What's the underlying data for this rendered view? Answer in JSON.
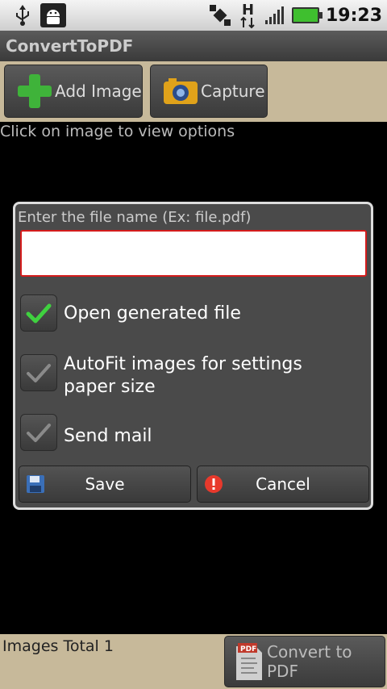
{
  "status_bar": {
    "time": "19:23"
  },
  "app": {
    "title": "ConvertToPDF"
  },
  "toolbar": {
    "add_image_label": "Add Image",
    "capture_label": "Capture"
  },
  "hint": "Click on image to view options",
  "dialog": {
    "file_label": "Enter the file name (Ex: file.pdf)",
    "file_value": "",
    "options": [
      {
        "label": "Open generated file",
        "checked": true
      },
      {
        "label": "AutoFit images for settings paper size",
        "checked": false
      },
      {
        "label": "Send mail",
        "checked": false
      }
    ],
    "save_label": "Save",
    "cancel_label": "Cancel"
  },
  "footer": {
    "images_total": "Images Total 1",
    "convert_label": "Convert to PDF"
  },
  "colors": {
    "check_on": "#3fd13f",
    "check_off": "#8a8a8a",
    "input_border": "#d41c1c",
    "toolbar_bg": "#c7b99a"
  }
}
